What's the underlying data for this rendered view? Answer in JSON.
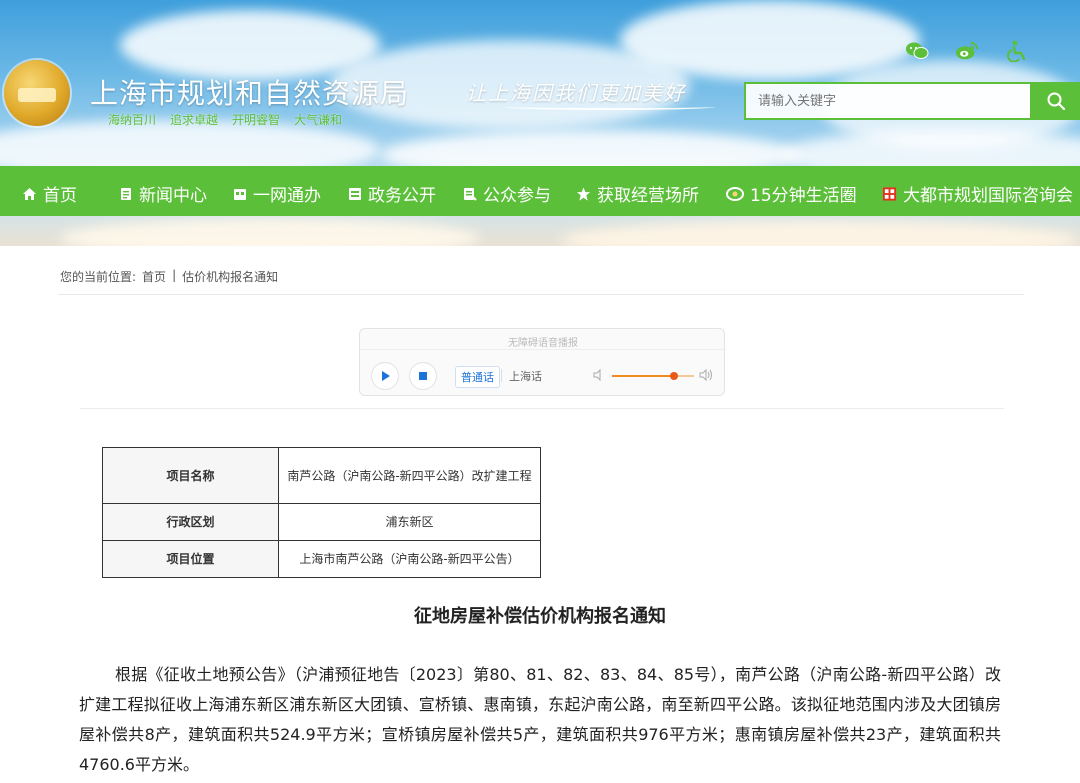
{
  "header": {
    "site_title": "上海市规划和自然资源局",
    "values": [
      "海纳百川",
      "追求卓越",
      "开明睿智",
      "大气谦和"
    ],
    "slogan": "让上海因我们更加美好",
    "top_icons": [
      "wechat-icon",
      "weibo-icon",
      "accessibility-icon"
    ],
    "search_placeholder": "请输入关键字"
  },
  "nav": {
    "items": [
      {
        "label": "首页",
        "icon": "home-icon"
      },
      {
        "label": "新闻中心",
        "icon": "news-icon"
      },
      {
        "label": "一网通办",
        "icon": "service-icon"
      },
      {
        "label": "政务公开",
        "icon": "document-icon"
      },
      {
        "label": "公众参与",
        "icon": "participation-icon"
      },
      {
        "label": "获取经营场所",
        "icon": "star-icon"
      },
      {
        "label": "15分钟生活圈",
        "icon": "circle-icon"
      },
      {
        "label": "大都市规划国际咨询会",
        "icon": "seal-icon"
      }
    ]
  },
  "breadcrumb": {
    "prefix": "您的当前位置:",
    "home": "首页",
    "current": "估价机构报名通知"
  },
  "player": {
    "title": "无障碍语音播报",
    "lang_primary": "普通话",
    "lang_secondary": "上海话",
    "volume_level": 0.75
  },
  "info_table": [
    {
      "key": "项目名称",
      "value": "南芦公路（沪南公路-新四平公路）改扩建工程"
    },
    {
      "key": "行政区划",
      "value": "浦东新区"
    },
    {
      "key": "项目位置",
      "value": "上海市南芦公路（沪南公路-新四平公告）"
    }
  ],
  "article": {
    "title": "征地房屋补偿估价机构报名通知",
    "paragraph": "根据《征收土地预公告》（沪浦预征地告〔2023〕第80、81、82、83、84、85号），南芦公路（沪南公路-新四平公路）改扩建工程拟征收上海浦东新区浦东新区大团镇、宣桥镇、惠南镇，东起沪南公路，南至新四平公路。该拟征地范围内涉及大团镇房屋补偿共8产，建筑面积共524.9平方米；宣桥镇房屋补偿共5产，建筑面积共976平方米；惠南镇房屋补偿共23产，建筑面积共4760.6平方米。"
  },
  "colors": {
    "brand_green": "#5cbf3a",
    "link_blue": "#1e73d8",
    "accent_orange": "#f08a1c"
  }
}
